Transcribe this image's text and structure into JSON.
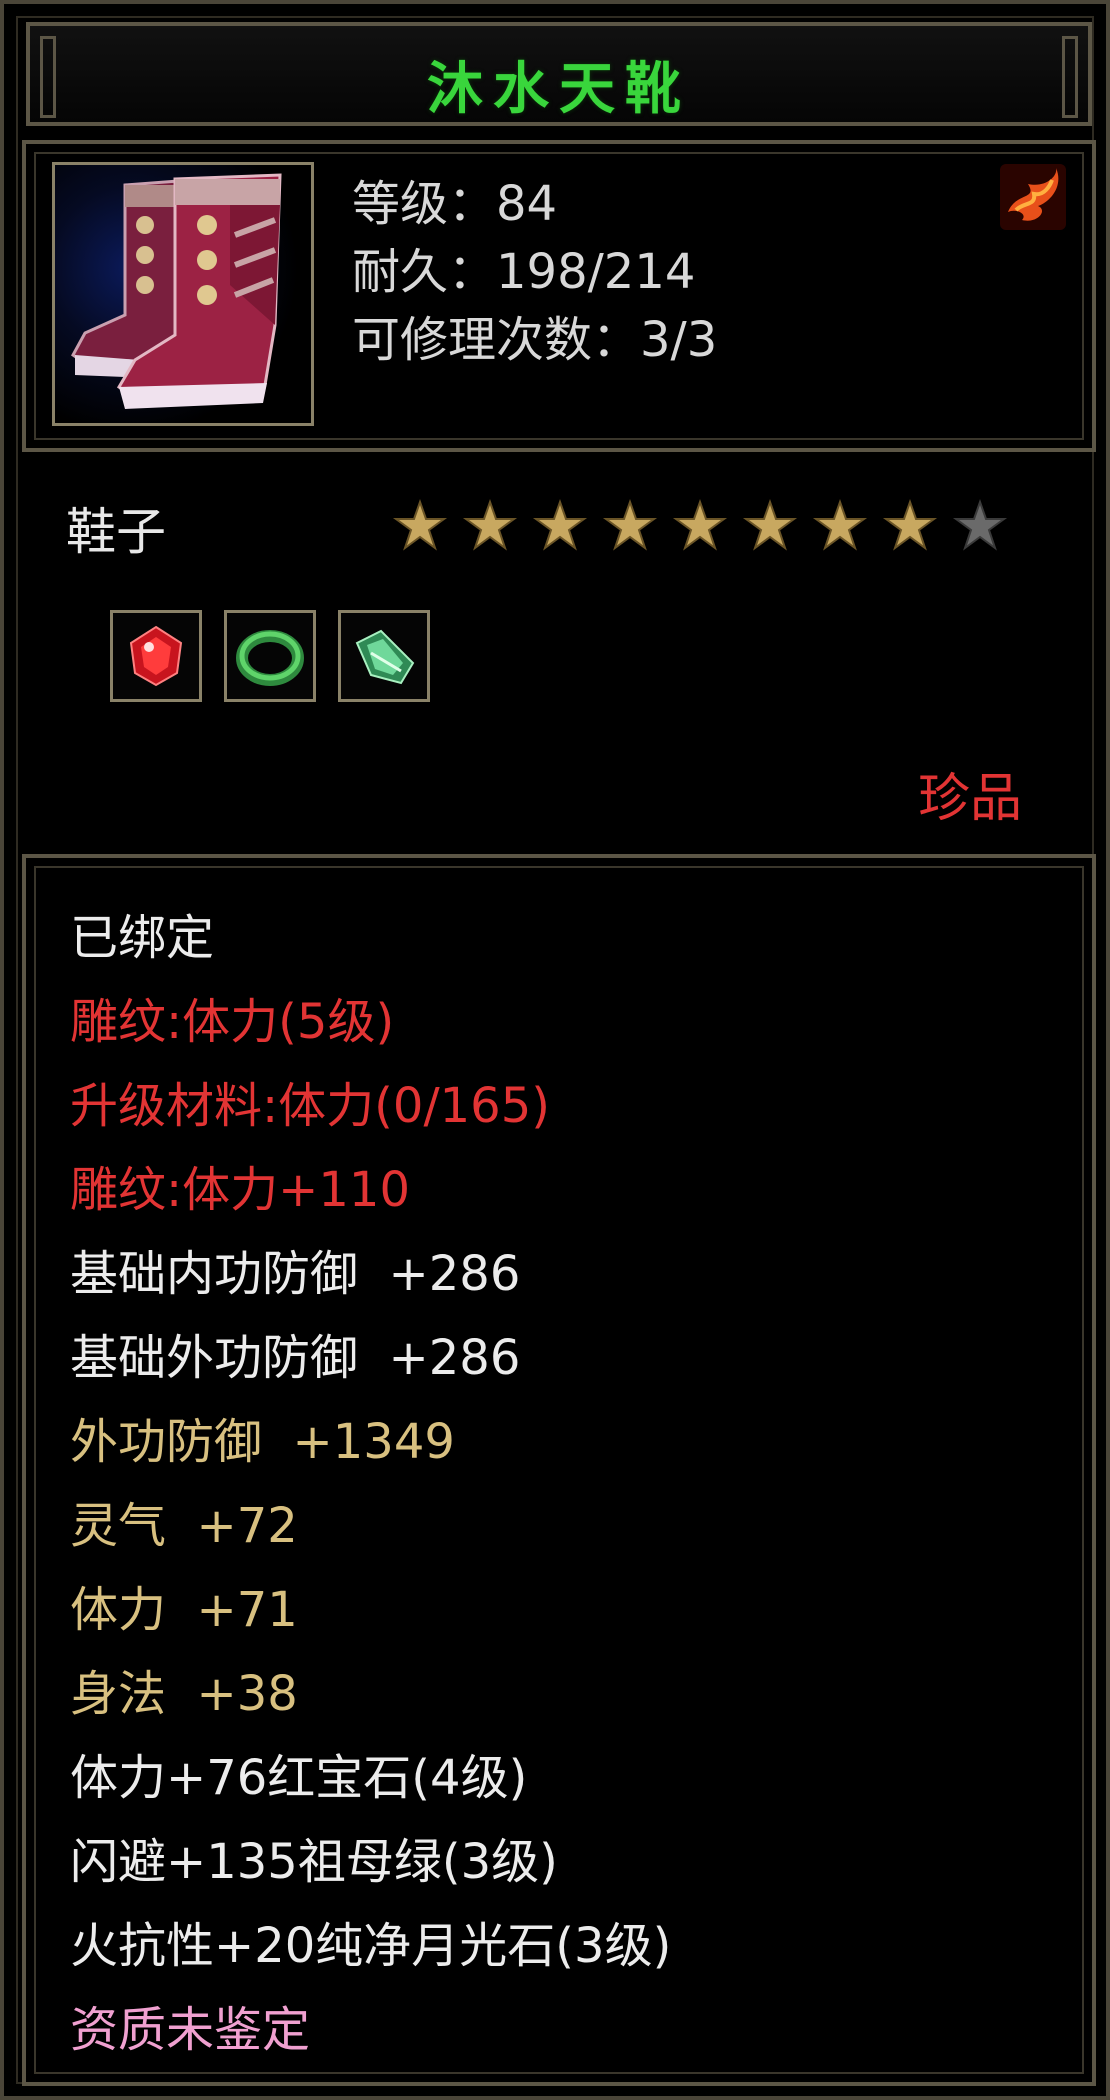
{
  "item": {
    "name": "沐水天靴",
    "stats": {
      "level": "等级：84",
      "durability": "耐久：198/214",
      "repairs": "可修理次数：3/3"
    },
    "type": "鞋子",
    "star_rating": 8,
    "star_max": 9,
    "gems": [
      "red-gem-icon",
      "green-ring-gem-icon",
      "green-crystal-gem-icon"
    ],
    "quality": "珍品"
  },
  "attributes": [
    {
      "text": "已绑定",
      "color": "white"
    },
    {
      "text": "雕纹:体力(5级)",
      "color": "red"
    },
    {
      "text": "升级材料:体力(0/165)",
      "color": "red"
    },
    {
      "text": "雕纹:体力+110",
      "color": "red"
    },
    {
      "text": "基础内功防御  +286",
      "color": "white"
    },
    {
      "text": "基础外功防御  +286",
      "color": "white"
    },
    {
      "text": "外功防御  +1349",
      "color": "gold"
    },
    {
      "text": "灵气  +72",
      "color": "gold"
    },
    {
      "text": "体力  +71",
      "color": "gold"
    },
    {
      "text": "身法  +38",
      "color": "gold"
    },
    {
      "text": "体力+76红宝石(4级)",
      "color": "white"
    },
    {
      "text": "闪避+135祖母绿(3级)",
      "color": "white"
    },
    {
      "text": "火抗性+20纯净月光石(3级)",
      "color": "white"
    },
    {
      "text": "资质未鉴定",
      "color": "pink"
    }
  ],
  "colors": {
    "title": "#39d63c",
    "red": "#e23434",
    "gold": "#d8c080",
    "white": "#ececec",
    "pink": "#f0a0d0",
    "star_filled": "#c8a860",
    "star_empty": "#6a6a6a"
  }
}
